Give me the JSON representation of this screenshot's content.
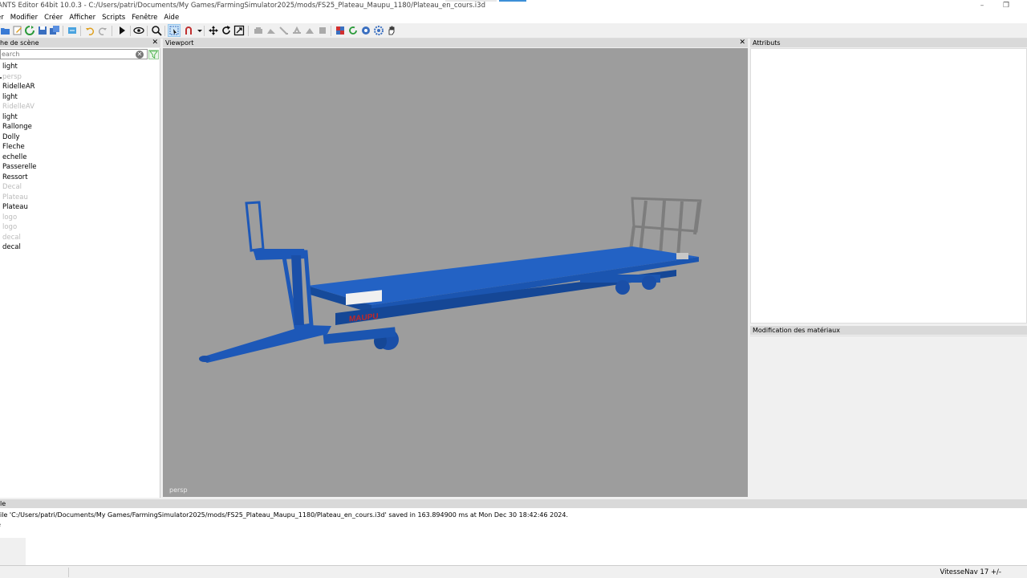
{
  "window": {
    "title": "ANTS Editor 64bit 10.0.3 - C:/Users/patri/Documents/My Games/FarmingSimulator2025/mods/FS25_Plateau_Maupu_1180/Plateau_en_cours.i3d",
    "minimize_glyph": "–",
    "restore_glyph": "❐"
  },
  "menubar": {
    "items": [
      "er",
      "Modifier",
      "Créer",
      "Afficher",
      "Scripts",
      "Fenêtre",
      "Aide"
    ]
  },
  "toolbar": {
    "icons": [
      "open-file-icon",
      "edit-icon",
      "refresh-icon",
      "save-icon",
      "save-all-icon",
      "export-icon",
      "undo-icon",
      "redo-icon",
      "play-icon",
      "eye-icon",
      "search-icon",
      "select-icon",
      "magnet-icon",
      "move-icon",
      "rotate-icon",
      "scale-icon",
      "tool-icon",
      "color-icon",
      "reload-icon",
      "settings-icon",
      "gear-icon",
      "hand-icon"
    ]
  },
  "scene_panel": {
    "title": "he de scène",
    "close_glyph": "✕",
    "search_placeholder": "earch",
    "clear_glyph": "✕",
    "items": [
      {
        "label": "light",
        "hidden": false
      },
      {
        "label": "persp",
        "hidden": true
      },
      {
        "label": "RidelleAR",
        "hidden": false
      },
      {
        "label": "light",
        "hidden": false
      },
      {
        "label": "RidelleAV",
        "hidden": true
      },
      {
        "label": "light",
        "hidden": false
      },
      {
        "label": "Rallonge",
        "hidden": false
      },
      {
        "label": "Dolly",
        "hidden": false
      },
      {
        "label": "Fleche",
        "hidden": false
      },
      {
        "label": "echelle",
        "hidden": false
      },
      {
        "label": "Passerelle",
        "hidden": false
      },
      {
        "label": "Ressort",
        "hidden": false
      },
      {
        "label": "Decal",
        "hidden": true
      },
      {
        "label": "Plateau",
        "hidden": true
      },
      {
        "label": "Plateau",
        "hidden": false
      },
      {
        "label": "logo",
        "hidden": true
      },
      {
        "label": "logo",
        "hidden": true
      },
      {
        "label": "decal",
        "hidden": true
      },
      {
        "label": "decal",
        "hidden": false
      }
    ]
  },
  "viewport": {
    "title": "Viewport",
    "close_glyph": "✕",
    "camera_label": "persp",
    "model": {
      "color": "#1f5fbf",
      "logo_text": "MAUPU"
    }
  },
  "attributes": {
    "title": "Attributs"
  },
  "materials": {
    "title": "Modification des matériaux"
  },
  "console": {
    "title": "le",
    "lines": [
      "File 'C:/Users/patri/Documents/My Games/FarmingSimulator2025/mods/FS25_Plateau_Maupu_1180/Plateau_en_cours.i3d' saved in 163.894900 ms at Mon Dec 30 18:42:46 2024.",
      "e"
    ],
    "prompt": "."
  },
  "statusbar": {
    "speed": "VitesseNav 17 +/-"
  },
  "colors": {
    "viewport_bg": "#9d9d9d",
    "panel_header": "#d9d9d9",
    "accent": "#0078d7"
  }
}
